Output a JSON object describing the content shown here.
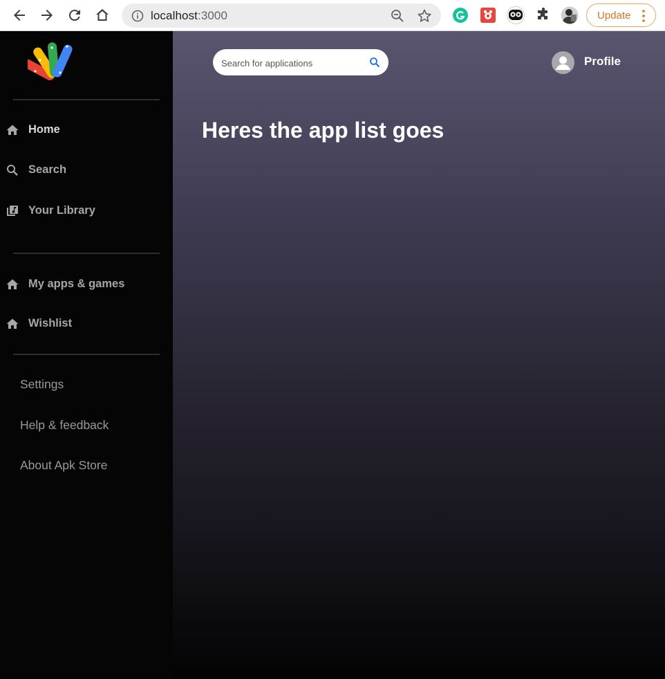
{
  "browser": {
    "url_host": "localhost",
    "url_port": ":3000",
    "update_label": "Update"
  },
  "icons": {
    "back": "arrow-left-icon",
    "forward": "arrow-right-icon",
    "reload": "reload-icon",
    "home": "home-icon",
    "site_info": "info-circle-icon",
    "zoom": "zoom-out-icon",
    "bookmark": "star-icon",
    "extensions": [
      "grammarly-icon",
      "bug-extension-icon",
      "owl-extension-icon",
      "puzzle-icon"
    ],
    "user": "avatar",
    "menu": "more-vertical-icon"
  },
  "sidebar": {
    "primary": [
      {
        "label": "Home",
        "icon": "home-icon"
      },
      {
        "label": "Search",
        "icon": "search-icon"
      },
      {
        "label": "Your Library",
        "icon": "library-icon"
      }
    ],
    "secondary": [
      {
        "label": "My apps & games",
        "icon": "home-icon"
      },
      {
        "label": "Wishlist",
        "icon": "home-icon"
      }
    ],
    "links": [
      {
        "label": "Settings"
      },
      {
        "label": "Help & feedback"
      },
      {
        "label": "About Apk Store"
      }
    ]
  },
  "main": {
    "search_placeholder": "Search for applications",
    "profile_label": "Profile",
    "heading": "Heres the app list goes"
  },
  "colors": {
    "sidebar_bg": "#050505",
    "main_gradient_top": "#5a5570",
    "main_gradient_bottom": "#030303",
    "search_icon": "#1a73e8",
    "update_border": "#e8a65c",
    "update_text": "#d4751c"
  }
}
